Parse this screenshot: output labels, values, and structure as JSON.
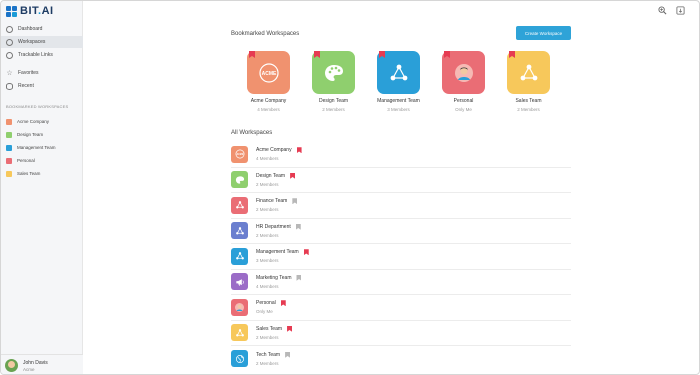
{
  "app": {
    "logo_text": "BIT",
    "logo_suffix": "AI",
    "logo_dot": "."
  },
  "sidebar": {
    "nav": [
      {
        "label": "Dashboard",
        "icon": "dashboard-icon"
      },
      {
        "label": "Workspaces",
        "icon": "workspaces-icon",
        "active": true
      },
      {
        "label": "Trackable Links",
        "icon": "link-icon"
      },
      {
        "label": "Favorites",
        "icon": "star-icon"
      },
      {
        "label": "Recent",
        "icon": "eye-icon"
      }
    ],
    "section_title": "BOOKMARKED WORKSPACES",
    "bookmarks": [
      {
        "label": "Acme Company",
        "color": "#f0926f"
      },
      {
        "label": "Design Team",
        "color": "#8fcf6e"
      },
      {
        "label": "Management Team",
        "color": "#2a9fd8"
      },
      {
        "label": "Personal",
        "color": "#ea6d75"
      },
      {
        "label": "Sales Team",
        "color": "#f7c85b"
      }
    ],
    "user": {
      "name": "John Davis",
      "org": "Acme"
    }
  },
  "header": {
    "icons": [
      "zoom-icon",
      "export-icon"
    ]
  },
  "bookmarked": {
    "title": "Bookmarked Workspaces",
    "create_label": "Create Workspace",
    "cards": [
      {
        "name": "Acme Company",
        "sub": "4 Members",
        "color": "#f0926f",
        "icon": "acme-logo-icon"
      },
      {
        "name": "Design Team",
        "sub": "2 Members",
        "color": "#8fcf6e",
        "icon": "palette-icon"
      },
      {
        "name": "Management Team",
        "sub": "3 Members",
        "color": "#2a9fd8",
        "icon": "network-icon"
      },
      {
        "name": "Personal",
        "sub": "Only Me",
        "color": "#ea6d75",
        "icon": "person-avatar-icon"
      },
      {
        "name": "Sales Team",
        "sub": "2 Members",
        "color": "#f7c85b",
        "icon": "network-icon"
      }
    ]
  },
  "all": {
    "title": "All Workspaces",
    "rows": [
      {
        "name": "Acme Company",
        "sub": "4 Members",
        "color": "#f0926f",
        "bookmarked": true,
        "icon": "acme-logo-icon"
      },
      {
        "name": "Design Team",
        "sub": "2 Members",
        "color": "#8fcf6e",
        "bookmarked": true,
        "icon": "palette-icon"
      },
      {
        "name": "Finance Team",
        "sub": "2 Members",
        "color": "#ea6d75",
        "bookmarked": false,
        "icon": "network-icon"
      },
      {
        "name": "HR Department",
        "sub": "2 Members",
        "color": "#6b7fcf",
        "bookmarked": false,
        "icon": "network-icon"
      },
      {
        "name": "Management Team",
        "sub": "3 Members",
        "color": "#2a9fd8",
        "bookmarked": true,
        "icon": "network-icon"
      },
      {
        "name": "Marketing Team",
        "sub": "4 Members",
        "color": "#9b6cc7",
        "bookmarked": false,
        "icon": "megaphone-icon"
      },
      {
        "name": "Personal",
        "sub": "Only Me",
        "color": "#ea6d75",
        "bookmarked": true,
        "icon": "person-avatar-icon"
      },
      {
        "name": "Sales Team",
        "sub": "2 Members",
        "color": "#f7c85b",
        "bookmarked": true,
        "icon": "network-icon"
      },
      {
        "name": "Tech Team",
        "sub": "2 Members",
        "color": "#2a9fd8",
        "bookmarked": false,
        "icon": "globe-icon"
      }
    ]
  },
  "colors": {
    "accent": "#2ea3d8",
    "bookmark_on": "#e63b52",
    "bookmark_off": "#b8b8b8"
  }
}
